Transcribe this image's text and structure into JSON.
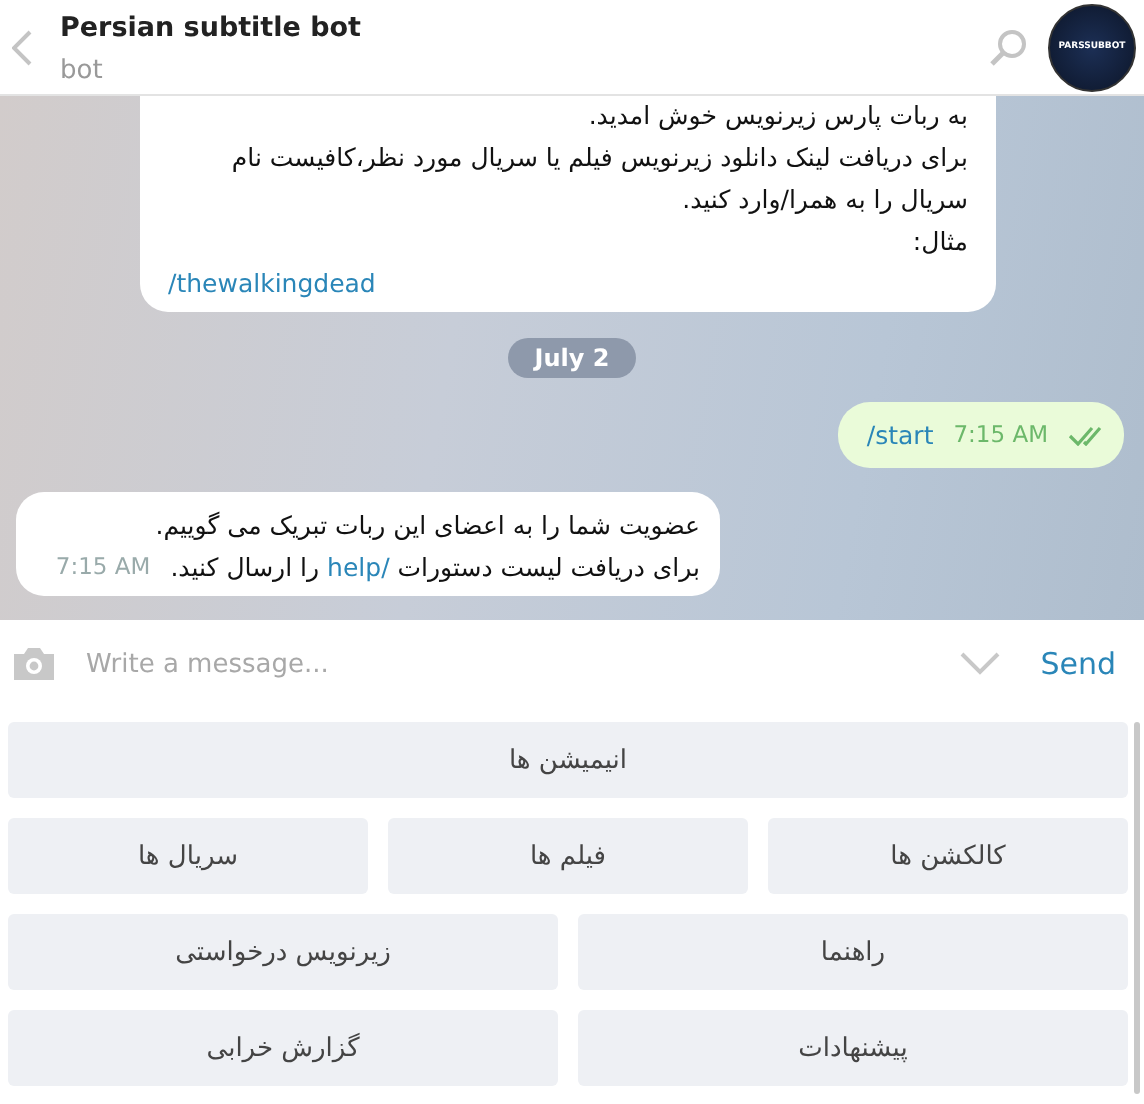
{
  "header": {
    "title": "Persian subtitle bot",
    "subtitle": "bot",
    "avatar_text": "PARSSUBBOT"
  },
  "messages": [
    {
      "kind": "incoming",
      "lines": [
        "به ربات پارس زیرنویس خوش امدید.",
        "برای دریافت لینک دانلود زیرنویس فیلم یا سریال مورد نظر،کافیست نام سریال را به همرا/وارد کنید.",
        "مثال:"
      ],
      "command": "/thewalkingdead"
    },
    {
      "kind": "date",
      "text": "July 2"
    },
    {
      "kind": "outgoing",
      "command": "/start",
      "time": "7:15 AM",
      "read": true
    },
    {
      "kind": "incoming_inline",
      "lines": [
        "عضویت شما را به اعضای این ربات تبریک می گوییم."
      ],
      "before": "برای دریافت لیست دستورات ",
      "command": "/help",
      "after": " را ارسال کنید.",
      "time": "7:15 AM"
    }
  ],
  "composer": {
    "placeholder": "Write a message...",
    "send": "Send"
  },
  "keyboard": [
    [
      "انیمیشن ها"
    ],
    [
      "کالکشن ها",
      "فیلم ها",
      "سریال ها"
    ],
    [
      "راهنما",
      "زیرنویس درخواستی"
    ],
    [
      "پیشنهادات",
      "گزارش خرابی"
    ]
  ]
}
